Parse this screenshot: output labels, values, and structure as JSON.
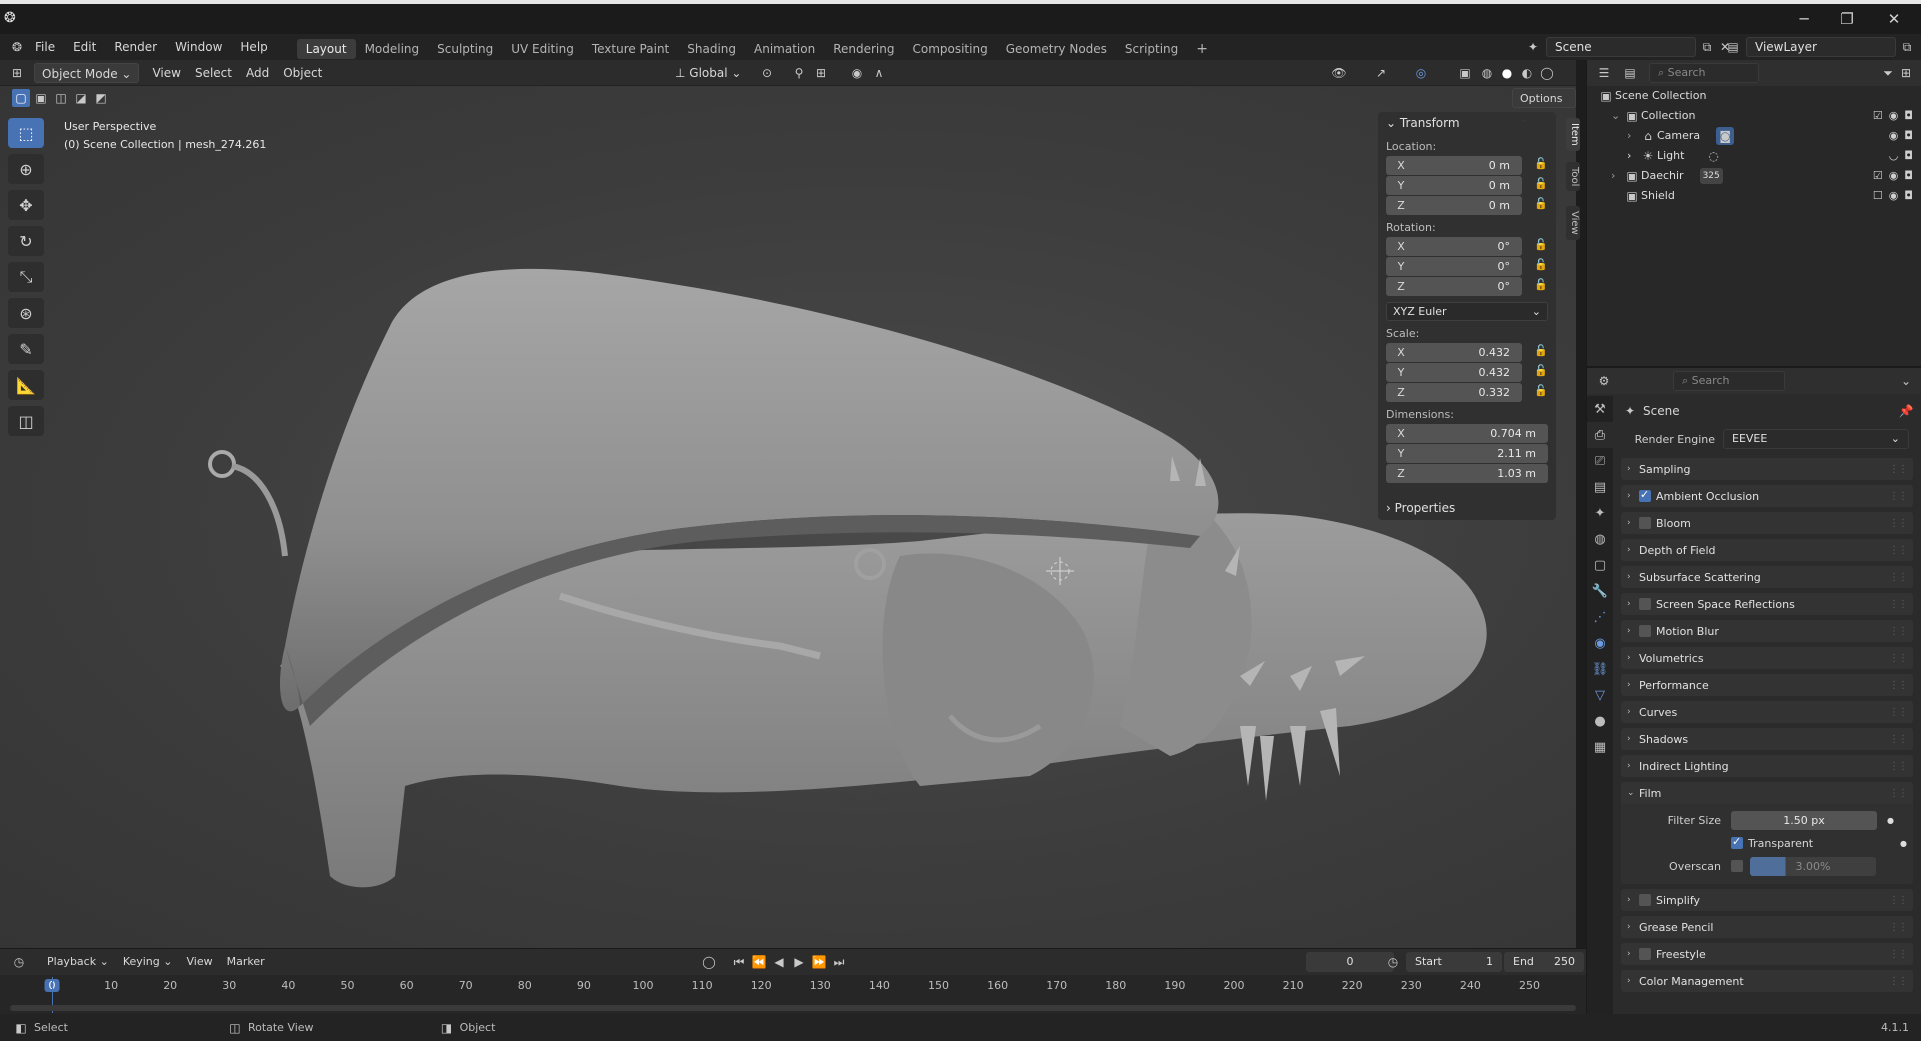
{
  "menubar": {
    "items": [
      "File",
      "Edit",
      "Render",
      "Window",
      "Help"
    ],
    "workspaces": [
      "Layout",
      "Modeling",
      "Sculpting",
      "UV Editing",
      "Texture Paint",
      "Shading",
      "Animation",
      "Rendering",
      "Compositing",
      "Geometry Nodes",
      "Scripting"
    ],
    "active_workspace": "Layout",
    "add_tab": "+",
    "scene": "Scene",
    "view_layer": "ViewLayer"
  },
  "viewport_header": {
    "mode": "Object Mode",
    "menus": [
      "View",
      "Select",
      "Add",
      "Object"
    ],
    "orientation": "Global",
    "options": "Options"
  },
  "viewport": {
    "perspective": "User Perspective",
    "context": "(0) Scene Collection | mesh_274.261"
  },
  "npanel": {
    "tabs": [
      "Item",
      "Tool",
      "View"
    ],
    "transform_title": "Transform",
    "location_label": "Location:",
    "location": [
      {
        "axis": "X",
        "value": "0 m"
      },
      {
        "axis": "Y",
        "value": "0 m"
      },
      {
        "axis": "Z",
        "value": "0 m"
      }
    ],
    "rotation_label": "Rotation:",
    "rotation": [
      {
        "axis": "X",
        "value": "0°"
      },
      {
        "axis": "Y",
        "value": "0°"
      },
      {
        "axis": "Z",
        "value": "0°"
      }
    ],
    "rotation_mode": "XYZ Euler",
    "scale_label": "Scale:",
    "scale": [
      {
        "axis": "X",
        "value": "0.432"
      },
      {
        "axis": "Y",
        "value": "0.432"
      },
      {
        "axis": "Z",
        "value": "0.332"
      }
    ],
    "dimensions_label": "Dimensions:",
    "dimensions": [
      {
        "axis": "X",
        "value": "0.704 m"
      },
      {
        "axis": "Y",
        "value": "2.11 m"
      },
      {
        "axis": "Z",
        "value": "1.03 m"
      }
    ],
    "properties_title": "Properties"
  },
  "outliner": {
    "search_placeholder": "Search",
    "items": [
      {
        "label": "Scene Collection"
      },
      {
        "label": "Collection"
      },
      {
        "label": "Camera"
      },
      {
        "label": "Light"
      },
      {
        "label": "Daechir",
        "badge": "325"
      },
      {
        "label": "Shield"
      }
    ]
  },
  "properties": {
    "search_placeholder": "Search",
    "breadcrumb": "Scene",
    "render_engine_label": "Render Engine",
    "render_engine": "EEVEE",
    "sections": [
      {
        "label": "Sampling"
      },
      {
        "label": "Ambient Occlusion"
      },
      {
        "label": "Bloom"
      },
      {
        "label": "Depth of Field"
      },
      {
        "label": "Subsurface Scattering"
      },
      {
        "label": "Screen Space Reflections"
      },
      {
        "label": "Motion Blur"
      },
      {
        "label": "Volumetrics"
      },
      {
        "label": "Performance"
      },
      {
        "label": "Curves"
      },
      {
        "label": "Shadows"
      },
      {
        "label": "Indirect Lighting"
      },
      {
        "label": "Film"
      }
    ],
    "film": {
      "filter_size_label": "Filter Size",
      "filter_size": "1.50 px",
      "transparent_label": "Transparent",
      "overscan_label": "Overscan",
      "overscan": "3.00%"
    },
    "sections_after": [
      {
        "label": "Simplify"
      },
      {
        "label": "Grease Pencil"
      },
      {
        "label": "Freestyle"
      },
      {
        "label": "Color Management"
      }
    ]
  },
  "timeline": {
    "menus": [
      "Playback",
      "Keying",
      "View",
      "Marker"
    ],
    "current_frame": "0",
    "start_label": "Start",
    "start": "1",
    "end_label": "End",
    "end": "250",
    "ticks": [
      "0",
      "10",
      "20",
      "30",
      "40",
      "50",
      "60",
      "70",
      "80",
      "90",
      "100",
      "110",
      "120",
      "130",
      "140",
      "150",
      "160",
      "170",
      "180",
      "190",
      "200",
      "210",
      "220",
      "230",
      "240",
      "250"
    ]
  },
  "statusbar": {
    "select": "Select",
    "rotate": "Rotate View",
    "object": "Object",
    "version": "4.1.1"
  },
  "colors": {
    "accent": "#4772b3",
    "background": "#1d1d1d",
    "panel": "#2b2b2b"
  }
}
